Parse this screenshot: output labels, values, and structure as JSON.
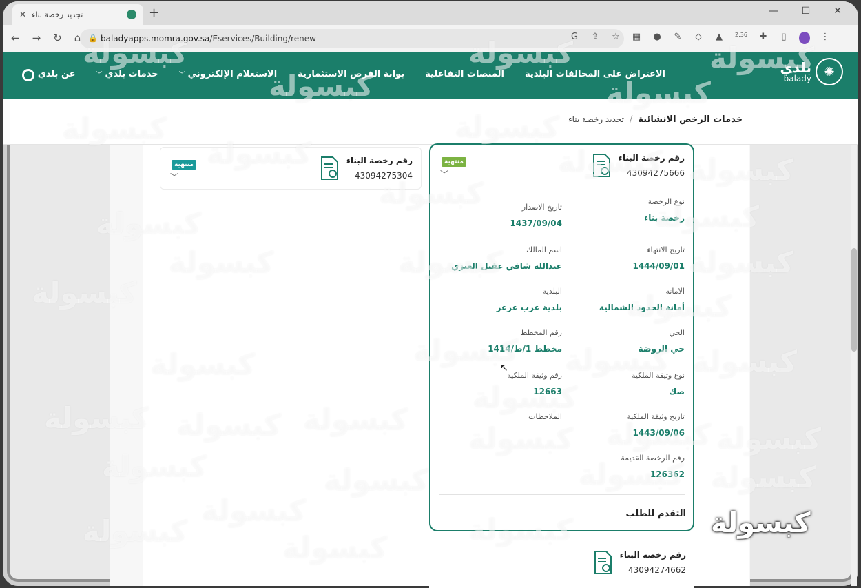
{
  "browser": {
    "tab_title": "تجديد رخصة بناء",
    "tab_close": "✕",
    "new_tab": "+",
    "url_host": "baladyapps.momra.gov.sa",
    "url_path": "/Eservices/Building/renew",
    "window_controls": [
      "—",
      "☐",
      "✕"
    ],
    "profile_time": "2:36"
  },
  "site": {
    "logo_ar": "بلدي",
    "logo_en": "balady",
    "nav": [
      {
        "label": "عن بلدي",
        "dropdown": false
      },
      {
        "label": "خدمات بلدي",
        "dropdown": true
      },
      {
        "label": "الاستعلام الإلكتروني",
        "dropdown": true
      },
      {
        "label": "بوابة الفرص الاستثمارية",
        "dropdown": false
      },
      {
        "label": "المنصات التفاعلية",
        "dropdown": false
      },
      {
        "label": "الاعتراض على المخالفات البلدية",
        "dropdown": false
      }
    ]
  },
  "breadcrumb": {
    "root": "خدمات الرخص الانشائية",
    "separator": "/",
    "current": "تجديد رخصة بناء"
  },
  "license_cards": {
    "main": {
      "label": "رقم رخصة البناء",
      "number": "43094275666",
      "status": "منتهية",
      "fields": [
        {
          "label": "نوع الرخصة",
          "value": "رخصة بناء"
        },
        {
          "label": "تاريخ الاصدار",
          "value": "1437/09/04"
        },
        {
          "label": "تاريخ الانتهاء",
          "value": "1444/09/01"
        },
        {
          "label": "اسم المالك",
          "value": "عبدالله شافي عقيل العنزي"
        },
        {
          "label": "الامانة",
          "value": "أمانة الحدود الشمالية"
        },
        {
          "label": "البلدية",
          "value": "بلدية غرب عرعر"
        },
        {
          "label": "الحي",
          "value": "حي الروضة"
        },
        {
          "label": "رقم المخطط",
          "value": "مخطط 1/ط/1414"
        },
        {
          "label": "نوع وثيقة الملكية",
          "value": "صك"
        },
        {
          "label": "رقم وثيقة الملكية",
          "value": "12663"
        },
        {
          "label": "تاريخ وثيقة الملكية",
          "value": "1443/09/06"
        },
        {
          "label": "الملاحظات",
          "value": ""
        },
        {
          "label": "رقم الرخصة القديمة",
          "value": "126362"
        }
      ],
      "apply_label": "التقدم للطلب"
    },
    "small": {
      "label": "رقم رخصة البناء",
      "number": "43094275304",
      "status": "منتهية"
    },
    "bottom": {
      "label": "رقم رخصة البناء",
      "number": "43094274662"
    }
  },
  "watermark": {
    "text": "كبسولة",
    "brand": "كبسولة"
  }
}
